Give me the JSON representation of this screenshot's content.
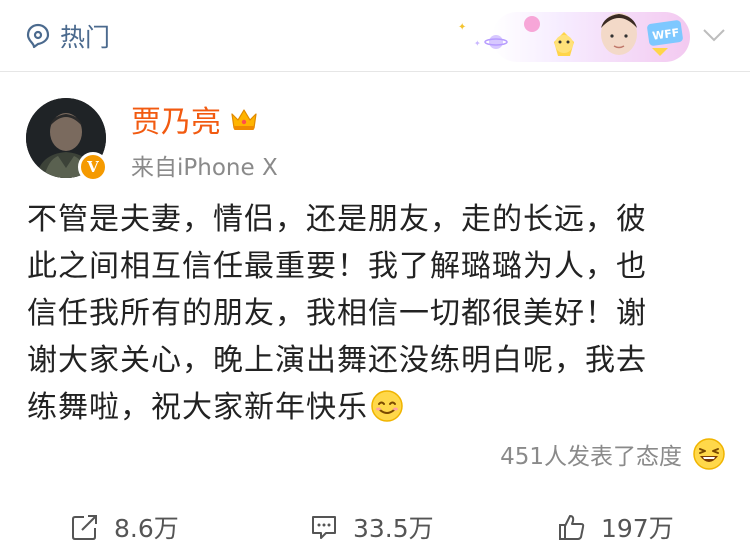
{
  "header": {
    "tab_label": "热门",
    "banner_text": "WFF"
  },
  "post": {
    "author": "贾乃亮",
    "source": "来自iPhone X",
    "verified_badge": "V",
    "lines": [
      "不管是夫妻，情侣，还是朋友，走的长远，彼",
      "此之间相互信任最重要！我了解璐璐为人，也",
      "信任我所有的朋友，我相信一切都很美好！谢",
      "谢大家关心，晚上演出舞还没练明白呢，我去",
      "练舞啦，祝大家新年快乐"
    ],
    "reactions_text": "451人发表了态度"
  },
  "actions": {
    "repost": "8.6万",
    "comment": "33.5万",
    "like": "197万"
  },
  "colors": {
    "name": "#f25a10",
    "link": "#4b6a8e",
    "muted": "#8a8a8a",
    "badge": "#f59a00"
  }
}
